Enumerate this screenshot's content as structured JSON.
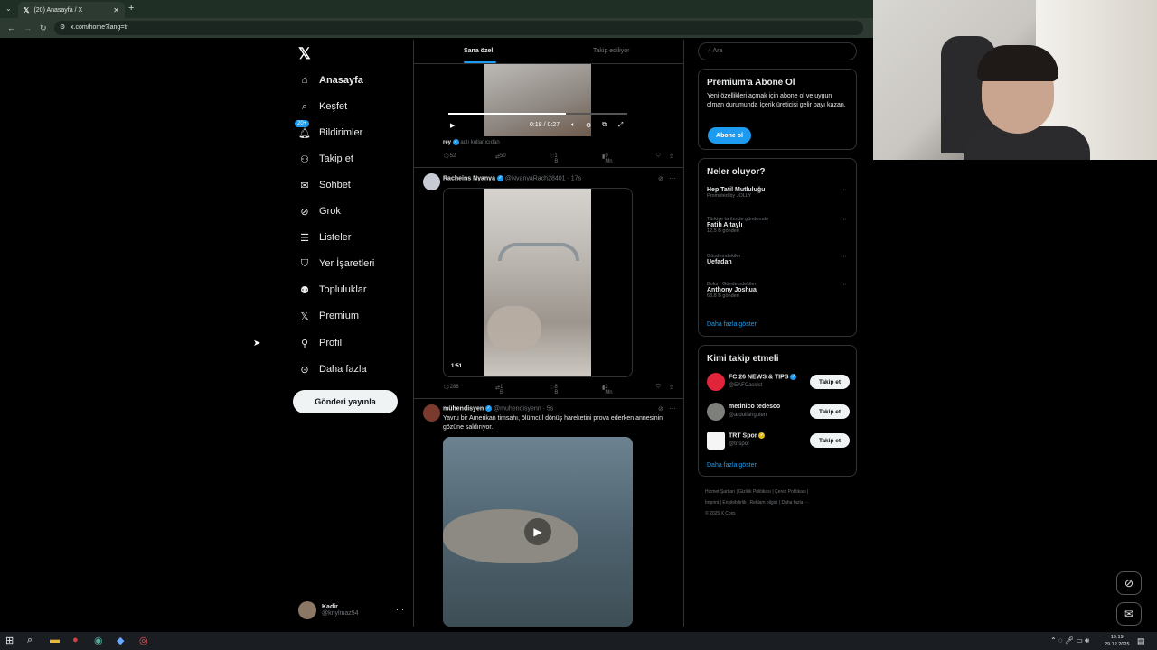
{
  "browser": {
    "tab_title": "(20) Anasayfa / X",
    "url": "x.com/home?lang=tr"
  },
  "sidebar": {
    "items": [
      {
        "label": "Anasayfa",
        "icon": "home-icon"
      },
      {
        "label": "Keşfet",
        "icon": "search-icon"
      },
      {
        "label": "Bildirimler",
        "icon": "bell-icon",
        "badge": "20+"
      },
      {
        "label": "Takip et",
        "icon": "person-plus-icon"
      },
      {
        "label": "Sohbet",
        "icon": "mail-icon"
      },
      {
        "label": "Grok",
        "icon": "grok-icon"
      },
      {
        "label": "Listeler",
        "icon": "list-icon"
      },
      {
        "label": "Yer İşaretleri",
        "icon": "bookmark-icon"
      },
      {
        "label": "Topluluklar",
        "icon": "people-icon"
      },
      {
        "label": "Premium",
        "icon": "x-icon"
      },
      {
        "label": "Profil",
        "icon": "person-icon"
      },
      {
        "label": "Daha fazla",
        "icon": "more-circle-icon"
      }
    ],
    "post_button": "Gönderi yayınla",
    "profile": {
      "name": "Kadir",
      "handle": "@knylmaz54"
    }
  },
  "main": {
    "tabs": [
      "Sana özel",
      "Takip ediliyor"
    ],
    "video1": {
      "time": "0:18 / 0:27"
    },
    "retweet_line": {
      "user": "rey",
      "text": "adlı kullanıcıdan"
    },
    "actions1": {
      "replies": "52",
      "reposts": "50",
      "likes": "1 B",
      "views": "9 Mn"
    },
    "tweet2": {
      "name": "Racheins Nyanya",
      "handle": "@NyanyaRach28401",
      "time": "17s",
      "duration": "1:51"
    },
    "actions2": {
      "replies": "288",
      "reposts": "1 B",
      "likes": "8 B",
      "views": "2 Mn"
    },
    "tweet3": {
      "name": "mühendisyen",
      "handle": "@muhendisyenn",
      "time": "5s",
      "text": "Yavru bir Amerikan timsahı, ölümcül dönüş hareketini prova ederken annesinin gözüne saldırıyor."
    }
  },
  "right": {
    "search_placeholder": "Ara",
    "premium": {
      "title": "Premium'a Abone Ol",
      "desc": "Yeni özellikleri açmak için abone ol ve uygun olman durumunda İçerik üreticisi gelir payı kazan.",
      "button": "Abone ol"
    },
    "trends": {
      "title": "Neler oluyor?",
      "items": [
        {
          "context": "",
          "title": "Hep Tatil Mutluluğu",
          "count": "Promoted by JOLLY"
        },
        {
          "context": "Türkiye tarihinde gündemde",
          "title": "Fatih Altaylı",
          "count": "12,5 B gönderi"
        },
        {
          "context": "Gündemdekiler",
          "title": "Uefadan",
          "count": ""
        },
        {
          "context": "Boks · Gündemdekiler",
          "title": "Anthony Joshua",
          "count": "63,8 B gönderi"
        }
      ],
      "show_more": "Daha fazla göster"
    },
    "who_to_follow": {
      "title": "Kimi takip etmeli",
      "items": [
        {
          "name": "FC 26 NEWS & TIPS",
          "handle": "@EAFCassist",
          "button": "Takip et"
        },
        {
          "name": "metinico tedesco",
          "handle": "@ardullahgulen",
          "button": "Takip et"
        },
        {
          "name": "TRT Spor",
          "handle": "@trtspor",
          "button": "Takip et"
        }
      ],
      "show_more": "Daha fazla göster"
    },
    "footer": {
      "line1": "Hizmet Şartları  |  Gizlilik Politikası  |  Çerez Politikası  |",
      "line2": "İmprint  |  Erişilebilirlik  |  Reklam bilgisi  |  Daha fazla ···",
      "line3": "© 2025 X Corp."
    }
  },
  "taskbar": {
    "time": "19:19",
    "date": "29.12.2025"
  },
  "colors": {
    "accent": "#1d9bf0",
    "background": "#000000",
    "border": "#2f3336",
    "muted": "#71767b"
  }
}
